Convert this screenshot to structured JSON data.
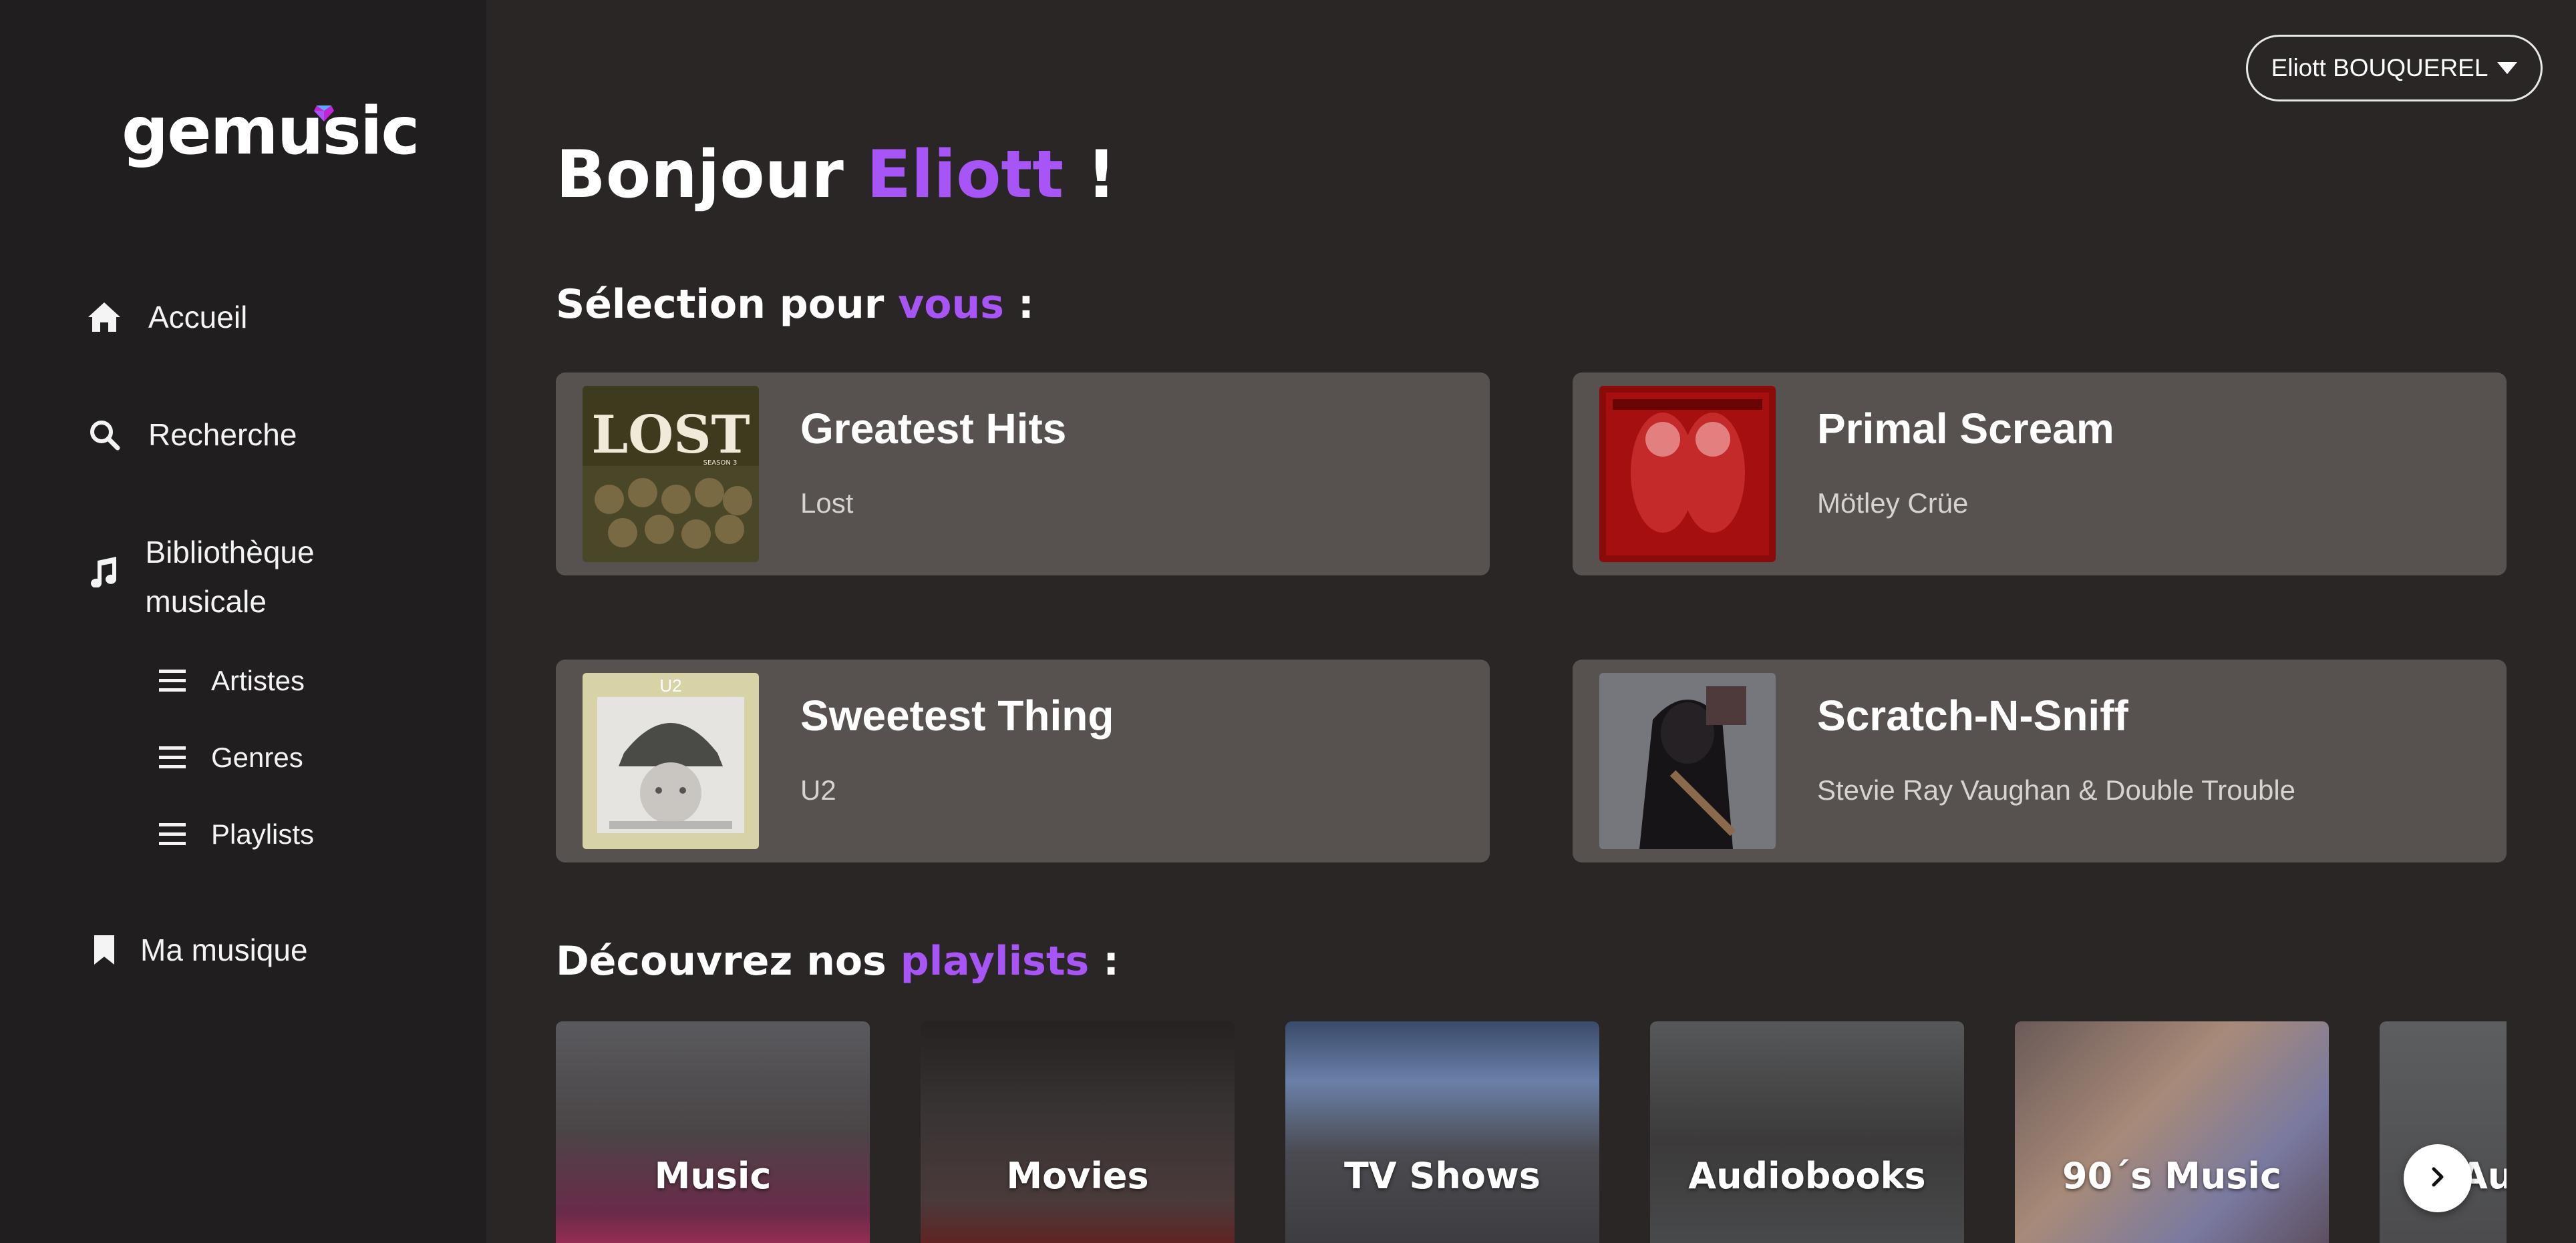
{
  "app": {
    "logo_text": "gemusic",
    "colors": {
      "accent": "#a855f7",
      "sidebar_bg": "#201e1e",
      "main_bg": "#2a2626",
      "card_bg": "#575250"
    }
  },
  "sidebar": {
    "items": [
      {
        "label": "Accueil",
        "icon": "home-icon"
      },
      {
        "label": "Recherche",
        "icon": "search-icon"
      },
      {
        "label": "Bibliothèque musicale",
        "icon": "music-note-icon"
      },
      {
        "label": "Ma musique",
        "icon": "bookmark-icon"
      }
    ],
    "subitems": [
      {
        "label": "Artistes",
        "icon": "list-icon"
      },
      {
        "label": "Genres",
        "icon": "list-icon"
      },
      {
        "label": "Playlists",
        "icon": "list-icon"
      }
    ]
  },
  "header": {
    "user_label": "Eliott BOUQUEREL",
    "greeting_prefix": "Bonjour",
    "greeting_name": "Eliott",
    "greeting_suffix": "!"
  },
  "selection": {
    "title_prefix": "Sélection pour",
    "title_accent": "vous",
    "title_suffix": ":",
    "cards": [
      {
        "title": "Greatest Hits",
        "subtitle": "Lost"
      },
      {
        "title": "Primal Scream",
        "subtitle": "Mötley Crüe"
      },
      {
        "title": "Sweetest Thing",
        "subtitle": "U2"
      },
      {
        "title": "Scratch-N-Sniff",
        "subtitle": "Stevie Ray Vaughan & Double Trouble"
      }
    ]
  },
  "playlists": {
    "title_prefix": "Découvrez nos",
    "title_accent": "playlists",
    "title_suffix": ":",
    "items": [
      {
        "name": "Music"
      },
      {
        "name": "Movies"
      },
      {
        "name": "TV Shows"
      },
      {
        "name": "Audiobooks"
      },
      {
        "name": "90´s Music"
      },
      {
        "name": "Aud"
      }
    ],
    "next_icon": "chevron-right-icon"
  },
  "covers": {
    "lost_text": "LOST",
    "lost_season": "SEASON 3",
    "u2_text": "U2"
  }
}
